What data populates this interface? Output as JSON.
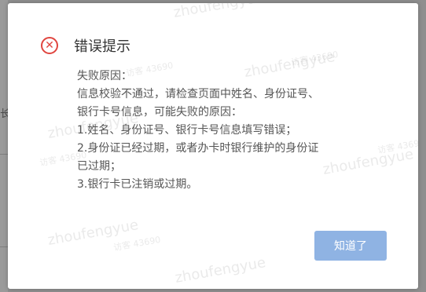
{
  "background": {
    "partial_text": "长"
  },
  "dialog": {
    "icon": "error-circle-x-icon",
    "icon_glyph": "✕",
    "title": "错误提示",
    "lines": [
      "失败原因：",
      "信息校验不通过，请检查页面中姓名、身份证号、",
      "银行卡号信息，可能失败的原因：",
      "1.姓名、身份证号、银行卡号信息填写错误；",
      "2.身份证已经过期，或者办卡时银行维护的身份证",
      "已过期；",
      "3.银行卡已注销或过期。"
    ],
    "ok_label": "知道了"
  },
  "watermarks": [
    "zhoufengyue",
    "访客 43690",
    "zhoufengyue",
    "访客 43690",
    "zhoufengyue",
    "访客 43690",
    "zhoufengyue",
    "访客 43690",
    "zhoufengyue",
    "zhoufengyue",
    "访客 43690"
  ],
  "colors": {
    "error": "#e0453f",
    "button": "#8fb3e3",
    "title": "#333333",
    "body_text": "#555555"
  }
}
